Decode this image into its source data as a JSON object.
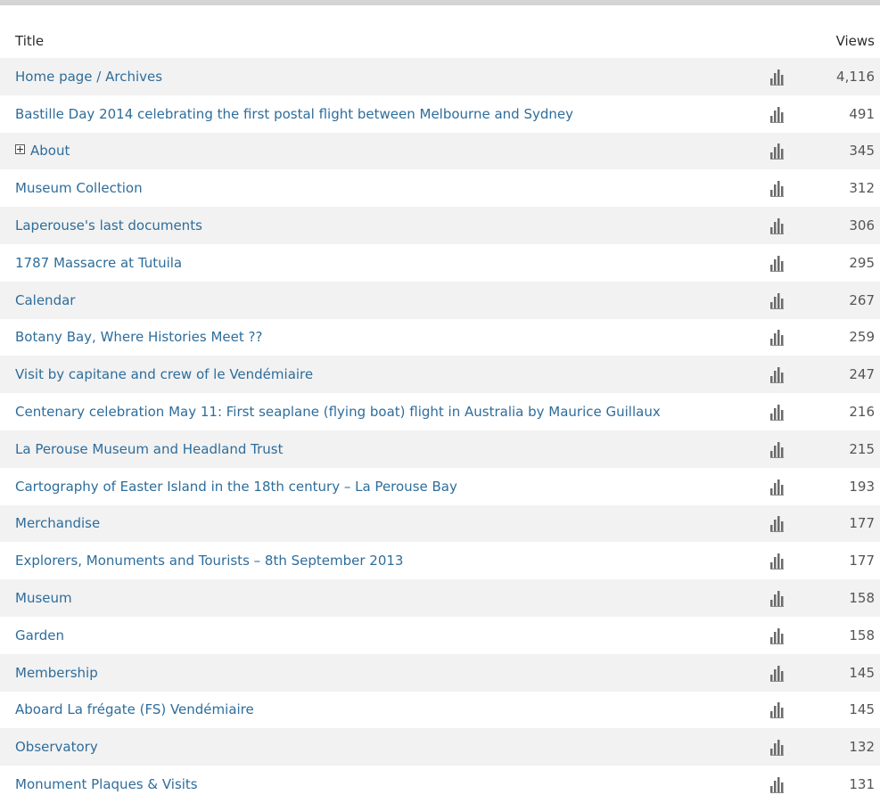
{
  "table": {
    "headers": {
      "title": "Title",
      "views": "Views"
    },
    "chart_icon": "bar-chart-icon",
    "rows": [
      {
        "title": "Home page / Archives",
        "views": "4,116"
      },
      {
        "title": "Bastille Day 2014 celebrating the first postal flight between Melbourne and Sydney",
        "views": "491"
      },
      {
        "title": "About",
        "views": "345",
        "expandable": true
      },
      {
        "title": "Museum Collection",
        "views": "312"
      },
      {
        "title": "Laperouse's last documents",
        "views": "306"
      },
      {
        "title": "1787 Massacre at Tutuila",
        "views": "295"
      },
      {
        "title": "Calendar",
        "views": "267"
      },
      {
        "title": "Botany Bay, Where Histories Meet ??",
        "views": "259"
      },
      {
        "title": "Visit by capitane and crew of le Vendémiaire",
        "views": "247"
      },
      {
        "title": "Centenary celebration May 11: First seaplane (flying boat) flight in Australia by Maurice Guillaux",
        "views": "216"
      },
      {
        "title": "La Perouse Museum and Headland Trust",
        "views": "215"
      },
      {
        "title": "Cartography of Easter Island in the 18th century – La Perouse Bay",
        "views": "193"
      },
      {
        "title": "Merchandise",
        "views": "177"
      },
      {
        "title": "Explorers, Monuments and Tourists – 8th September 2013",
        "views": "177"
      },
      {
        "title": "Museum",
        "views": "158"
      },
      {
        "title": "Garden",
        "views": "158"
      },
      {
        "title": "Membership",
        "views": "145"
      },
      {
        "title": "Aboard La frégate (FS) Vendémiaire",
        "views": "145"
      },
      {
        "title": "Observatory",
        "views": "132"
      },
      {
        "title": "Monument Plaques & Visits",
        "views": "131"
      }
    ]
  }
}
